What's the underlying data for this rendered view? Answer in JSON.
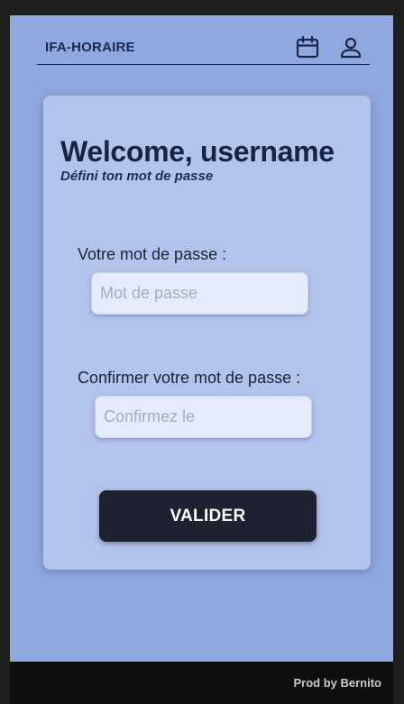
{
  "header": {
    "app_title": "IFA-HORAIRE",
    "icons": [
      "calendar-icon",
      "user-icon"
    ]
  },
  "card": {
    "welcome": "Welcome, username",
    "subtitle": "Défini ton mot de passe",
    "password_label": "Votre mot de passe :",
    "password_placeholder": "Mot de passe",
    "password_value": "",
    "confirm_label": "Confirmer votre mot de passe :",
    "confirm_placeholder": "Confirmez le",
    "confirm_value": "",
    "submit_label": "VALIDER"
  },
  "footer": {
    "credit": "Prod by Bernito"
  },
  "colors": {
    "background": "#8fa8df",
    "card": "#b2c3ec",
    "primary_text": "#152447",
    "button": "#1e2230",
    "footer": "#0e0e0e"
  }
}
